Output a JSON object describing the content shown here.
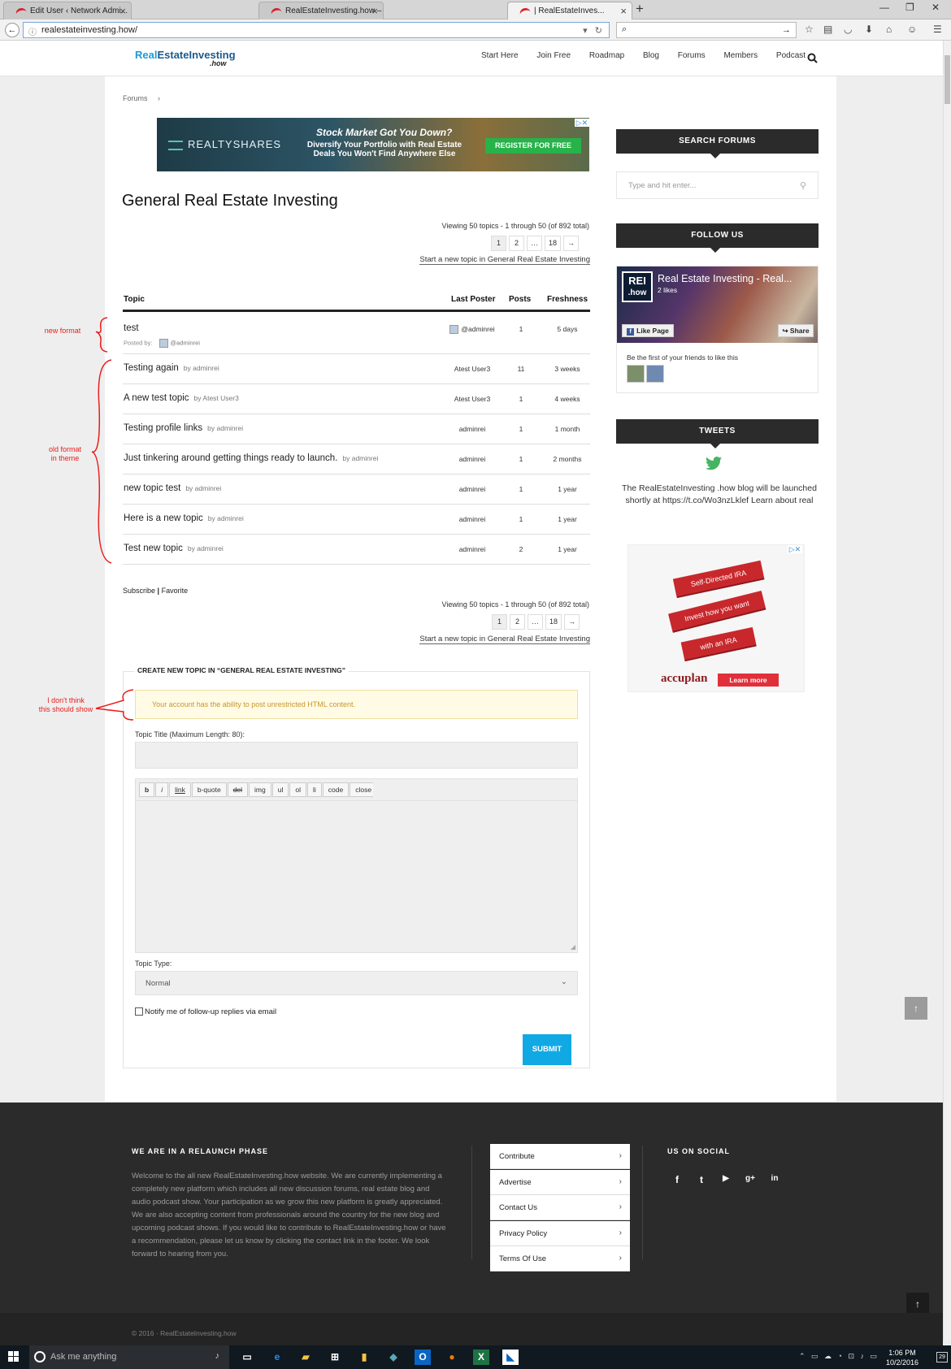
{
  "browser": {
    "tabs": [
      {
        "label": "Edit User ‹ Network Admi..."
      },
      {
        "label": "RealEstateInvesting.how – ..."
      },
      {
        "label": "| RealEstateInves..."
      }
    ],
    "url": "realestateinvesting.how/"
  },
  "site": {
    "logo": {
      "real": "Real",
      "estate": "EstateInvesting",
      "how": ".how"
    },
    "nav": [
      "Start Here",
      "Join Free",
      "Roadmap",
      "Blog",
      "Forums",
      "Members",
      "Podcast"
    ]
  },
  "breadcrumb": {
    "root": "Forums",
    "sep": "›"
  },
  "banner_ad": {
    "brand": "REALTYSHARES",
    "headline": "Stock Market Got You Down?",
    "sub": "Diversify Your Portfolio with Real Estate Deals You Won't Find Anywhere Else",
    "cta": "REGISTER FOR FREE"
  },
  "forum": {
    "title": "General Real Estate Investing",
    "viewing": "Viewing 50 topics - 1 through 50 (of 892 total)",
    "pages": [
      "1",
      "2",
      "…",
      "18",
      "→"
    ],
    "new_topic_link": "Start a new topic in General Real Estate Investing",
    "columns": {
      "topic": "Topic",
      "last_poster": "Last Poster",
      "posts": "Posts",
      "freshness": "Freshness"
    },
    "first_topic": {
      "title": "test",
      "posted_by_label": "Posted by:",
      "author": "@adminrei",
      "last_poster": "@adminrei",
      "posts": "1",
      "freshness": "5 days"
    },
    "topics": [
      {
        "title": "Testing again",
        "by": "by adminrei",
        "last_poster": "Atest User3",
        "posts": "11",
        "freshness": "3 weeks"
      },
      {
        "title": "A new test topic",
        "by": "by Atest User3",
        "last_poster": "Atest User3",
        "posts": "1",
        "freshness": "4 weeks"
      },
      {
        "title": "Testing profile links",
        "by": "by adminrei",
        "last_poster": "adminrei",
        "posts": "1",
        "freshness": "1 month"
      },
      {
        "title": "Just tinkering around getting things ready to launch.",
        "by": "by adminrei",
        "last_poster": "adminrei",
        "posts": "1",
        "freshness": "2 months"
      },
      {
        "title": "new topic test",
        "by": "by adminrei",
        "last_poster": "adminrei",
        "posts": "1",
        "freshness": "1 year"
      },
      {
        "title": "Here is a new topic",
        "by": "by adminrei",
        "last_poster": "adminrei",
        "posts": "1",
        "freshness": "1 year"
      },
      {
        "title": "Test new topic",
        "by": "by adminrei",
        "last_poster": "adminrei",
        "posts": "2",
        "freshness": "1 year"
      }
    ],
    "subscribe": "Subscribe",
    "pipe": "|",
    "favorite": "Favorite"
  },
  "new_topic_form": {
    "legend": "CREATE NEW TOPIC IN “GENERAL REAL ESTATE INVESTING”",
    "notice": "Your account has the ability to post unrestricted HTML content.",
    "title_label": "Topic Title (Maximum Length: 80):",
    "quicktags": [
      "b",
      "i",
      "link",
      "b-quote",
      "del",
      "img",
      "ul",
      "ol",
      "li",
      "code",
      "close tags"
    ],
    "type_label": "Topic Type:",
    "type_value": "Normal",
    "notify_label": "Notify me of follow-up replies via email",
    "submit": "SUBMIT"
  },
  "sidebar": {
    "search_heading": "SEARCH FORUMS",
    "search_placeholder": "Type and hit enter...",
    "follow_heading": "FOLLOW US",
    "fb": {
      "logo_top": "REI",
      "logo_bottom": ".how",
      "page_title": "Real Estate Investing - Real...",
      "likes": "2 likes",
      "like_btn": "Like Page",
      "share_btn": "Share",
      "friends": "Be the first of your friends to like this"
    },
    "tweets_heading": "TWEETS",
    "tweet": "The RealEstateInvesting .how blog will be launched shortly at https://t.co/Wo3nzLklef Learn about real",
    "ad2": {
      "r1": "Self-Directed IRA",
      "r2": "Invest how you want",
      "r3": "with an IRA",
      "brand": "accuplan",
      "cta": "Learn more"
    }
  },
  "annotations": {
    "new_format": "new format",
    "old_format": "old format\nin theme",
    "dont_show": "I don't think\nthis should show"
  },
  "footer": {
    "relaunch_heading": "WE ARE IN A RELAUNCH PHASE",
    "relaunch_text": "Welcome to the all new RealEstateInvesting.how website. We are currently implementing a completely new platform which includes all new discussion forums, real estate blog and audio podcast show. Your participation as we grow this new platform is greatly appreciated. We are also accepting content from professionals around the country for the new blog and upcoming podcast shows. If you would like to contribute to RealEstateInvesting.how or have a recommendation, please let us know by clicking the contact link in the footer. We look forward to hearing from you.",
    "links": [
      "Contribute",
      "Advertise",
      "Contact Us",
      "Privacy Policy",
      "Terms Of Use"
    ],
    "social_heading": "US ON SOCIAL",
    "social": [
      "f",
      "t",
      "▶",
      "g+",
      "in"
    ],
    "copyright": "© 2016 · RealEstateInvesting.how"
  },
  "taskbar": {
    "search_placeholder": "Ask me anything",
    "time": "1:06 PM",
    "date": "10/2/2016",
    "notif_count": "29"
  },
  "colors": {
    "accent": "#11a9e4",
    "dark": "#2b2b2b",
    "annotation": "#ea1c1c"
  }
}
